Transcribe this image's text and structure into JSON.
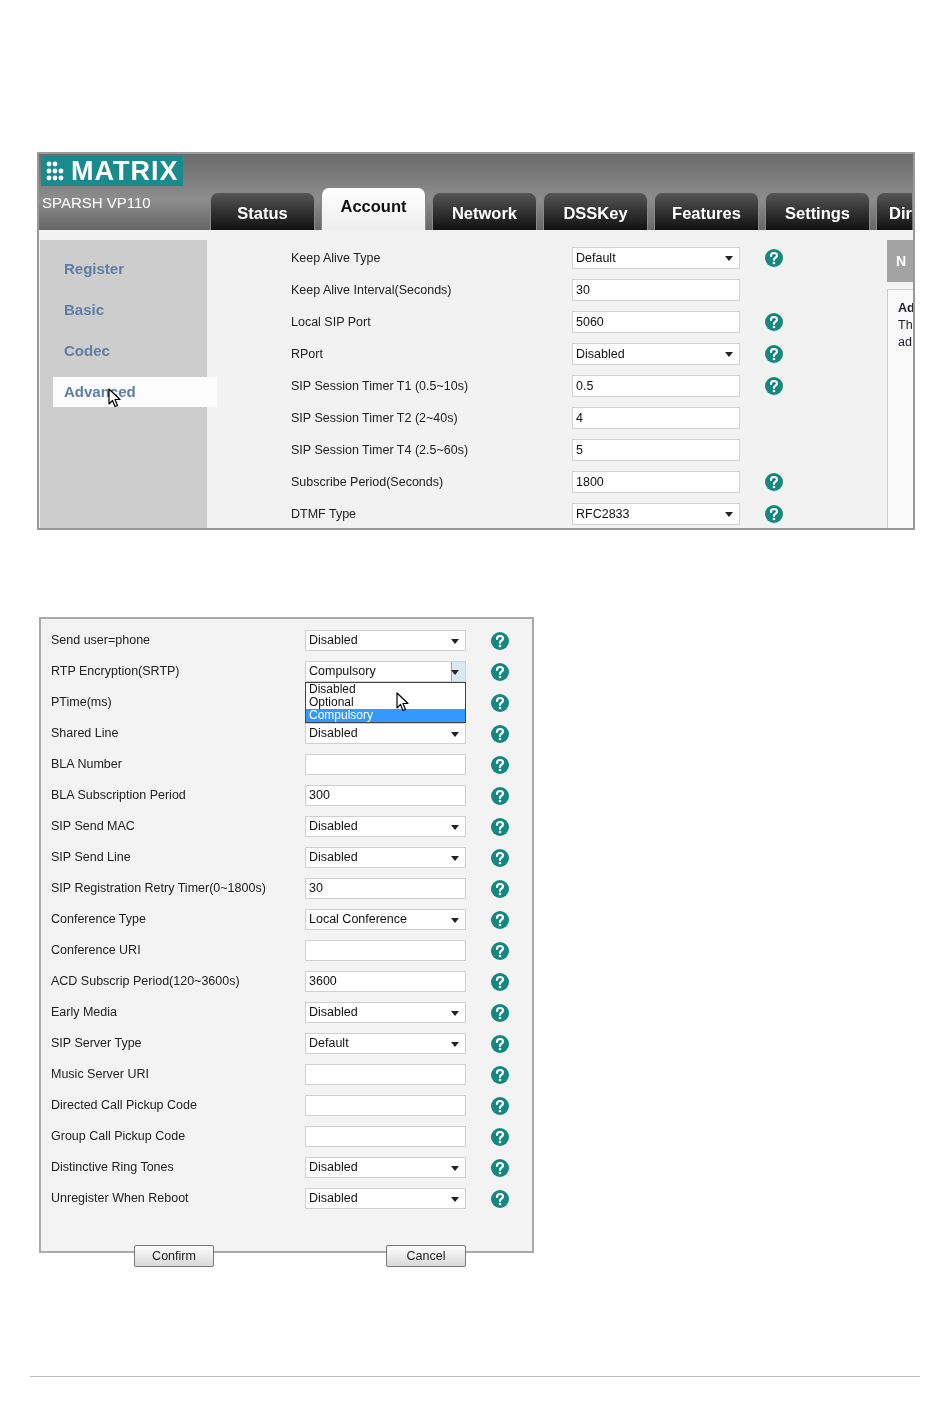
{
  "header": {
    "logo": "MATRIX",
    "model": "SPARSH VP110"
  },
  "tabs": [
    {
      "label": "Status",
      "selected": false
    },
    {
      "label": "Account",
      "selected": true
    },
    {
      "label": "Network",
      "selected": false
    },
    {
      "label": "DSSKey",
      "selected": false
    },
    {
      "label": "Features",
      "selected": false
    },
    {
      "label": "Settings",
      "selected": false
    },
    {
      "label": "Dir",
      "selected": false
    }
  ],
  "sidebar": {
    "items": [
      {
        "label": "Register",
        "selected": false
      },
      {
        "label": "Basic",
        "selected": false
      },
      {
        "label": "Codec",
        "selected": false
      },
      {
        "label": "Advanced",
        "selected": true
      }
    ]
  },
  "settings": [
    {
      "label": "Keep Alive Type",
      "kind": "select",
      "value": "Default",
      "help": true
    },
    {
      "label": "Keep Alive Interval(Seconds)",
      "kind": "text",
      "value": "30",
      "help": false
    },
    {
      "label": "Local SIP Port",
      "kind": "text",
      "value": "5060",
      "help": true
    },
    {
      "label": "RPort",
      "kind": "select",
      "value": "Disabled",
      "help": true
    },
    {
      "label": "SIP Session Timer T1 (0.5~10s)",
      "kind": "text",
      "value": "0.5",
      "help": true
    },
    {
      "label": "SIP Session Timer T2 (2~40s)",
      "kind": "text",
      "value": "4",
      "help": false
    },
    {
      "label": "SIP Session Timer T4 (2.5~60s)",
      "kind": "text",
      "value": "5",
      "help": false
    },
    {
      "label": "Subscribe Period(Seconds)",
      "kind": "text",
      "value": "1800",
      "help": true
    },
    {
      "label": "DTMF Type",
      "kind": "select",
      "value": "RFC2833",
      "help": true
    }
  ],
  "notes_panel": {
    "title": "N",
    "heading": "Ad",
    "lines": [
      "Th",
      "ad"
    ]
  },
  "advanced_form": {
    "rows": [
      {
        "label": "Send user=phone",
        "kind": "select",
        "value": "Disabled",
        "help": true
      },
      {
        "label": "RTP Encryption(SRTP)",
        "kind": "select",
        "value": "Compulsory",
        "help": true,
        "expanded": true,
        "options": [
          {
            "label": "Disabled",
            "selected": false
          },
          {
            "label": "Optional",
            "selected": false
          },
          {
            "label": "Compulsory",
            "selected": true
          }
        ]
      },
      {
        "label": "PTime(ms)",
        "help": true
      },
      {
        "label": "Shared Line",
        "kind": "select",
        "value": "Disabled",
        "help": true
      },
      {
        "label": "BLA Number",
        "kind": "text",
        "help": true
      },
      {
        "label": "BLA Subscription Period",
        "kind": "text",
        "value": "300",
        "help": true
      },
      {
        "label": "SIP Send MAC",
        "kind": "select",
        "value": "Disabled",
        "help": true
      },
      {
        "label": "SIP Send Line",
        "kind": "select",
        "value": "Disabled",
        "help": true
      },
      {
        "label": "SIP Registration Retry Timer(0~1800s)",
        "kind": "text",
        "value": "30",
        "help": true
      },
      {
        "label": "Conference Type",
        "kind": "select",
        "value": "Local Conference",
        "help": true
      },
      {
        "label": "Conference URI",
        "kind": "text",
        "help": true
      },
      {
        "label": "ACD Subscrip Period(120~3600s)",
        "kind": "text",
        "value": "3600",
        "help": true
      },
      {
        "label": "Early Media",
        "kind": "select",
        "value": "Disabled",
        "help": true
      },
      {
        "label": "SIP Server Type",
        "kind": "select",
        "value": "Default",
        "help": true
      },
      {
        "label": "Music Server URI",
        "kind": "text",
        "help": true
      },
      {
        "label": "Directed Call Pickup Code",
        "kind": "text",
        "help": true
      },
      {
        "label": "Group Call Pickup Code",
        "kind": "text",
        "help": true
      },
      {
        "label": "Distinctive Ring Tones",
        "kind": "select",
        "value": "Disabled",
        "help": true
      },
      {
        "label": "Unregister When Reboot",
        "kind": "select",
        "value": "Disabled",
        "help": true
      }
    ],
    "buttons": [
      "Confirm",
      "Cancel"
    ]
  }
}
